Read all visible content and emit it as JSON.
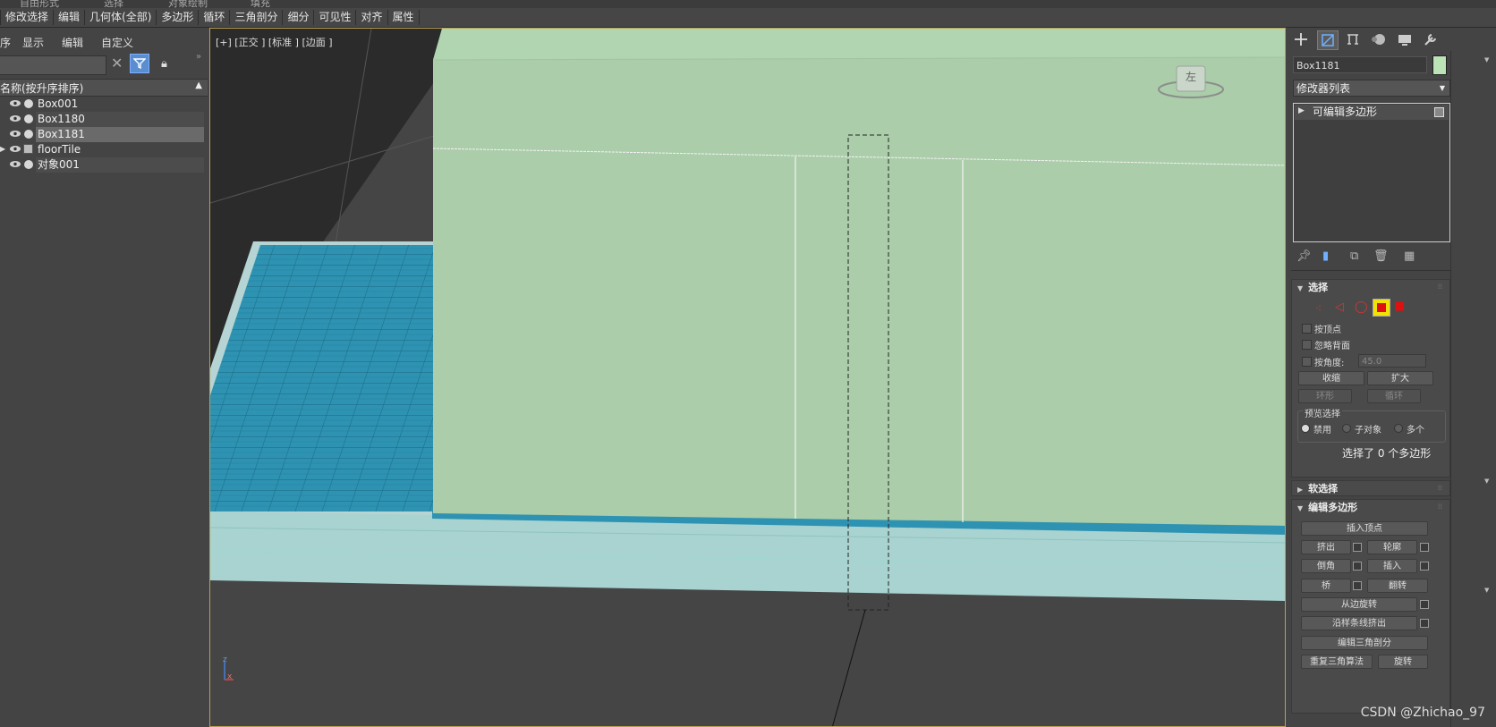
{
  "ribbon_top": [
    "自由形式",
    "选择",
    "对象绘制",
    "填充"
  ],
  "ribbon": [
    "修改选择",
    "编辑",
    "几何体(全部)",
    "多边形",
    "循环",
    "三角剖分",
    "细分",
    "可见性",
    "对齐",
    "属性"
  ],
  "explorer": {
    "menu": [
      "序",
      "显示",
      "编辑",
      "自定义"
    ],
    "column_header": "名称(按升序排序)",
    "sort_indicator": "▲",
    "rows": [
      {
        "label": "Box001"
      },
      {
        "label": "Box1180"
      },
      {
        "label": "Box1181"
      },
      {
        "label": "floorTile"
      },
      {
        "label": "对象001"
      }
    ],
    "more_glyph": "»"
  },
  "viewport": {
    "label": "[+] [正交 ] [标准 ] [边面 ]",
    "viewcube_face": "左",
    "axis_z": "z",
    "axis_x": "x"
  },
  "command_panel": {
    "object_name": "Box1181",
    "object_color": "#bce3b8",
    "modifier_list": "修改器列表",
    "stack_item": "可编辑多边形",
    "selection": {
      "title": "选择",
      "by_vertex": "按顶点",
      "ignore_backfacing": "忽略背面",
      "by_angle": "按角度:",
      "angle_value": "45.0",
      "shrink": "收缩",
      "grow": "扩大",
      "ring": "环形",
      "loop": "循环",
      "preview_title": "预览选择",
      "preview_off": "禁用",
      "preview_subobj": "子对象",
      "preview_multi": "多个",
      "status": "选择了 0 个多边形"
    },
    "soft_selection": {
      "title": "软选择"
    },
    "edit_polygons": {
      "title": "编辑多边形",
      "insert_vertex": "插入顶点",
      "extrude": "挤出",
      "outline": "轮廓",
      "bevel": "倒角",
      "inset": "插入",
      "bridge": "桥",
      "flip": "翻转",
      "hinge": "从边旋转",
      "extrude_along_spline": "沿样条线挤出",
      "edit_triangulation": "编辑三角剖分",
      "retriangulate": "重复三角算法",
      "turn": "旋转"
    }
  },
  "watermark": "CSDN @Zhichao_97"
}
